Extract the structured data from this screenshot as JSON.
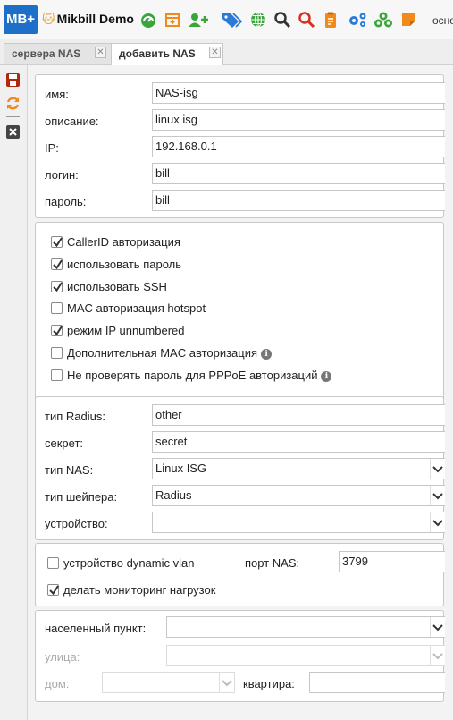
{
  "app": {
    "logo": "MB+",
    "brand": "Mikbill Demo",
    "top_right": "осно"
  },
  "tabs": [
    {
      "label": "сервера NAS"
    },
    {
      "label": "добавить NAS"
    }
  ],
  "toolbar_icons": [
    "dashboard-icon",
    "calendar-icon",
    "add-user-icon",
    "tags-icon",
    "globe-icon",
    "search-icon",
    "search-red-icon",
    "clipboard-icon",
    "gears-icon",
    "network-icon",
    "note-icon"
  ],
  "general": {
    "name_label": "имя:",
    "name_value": "NAS-isg",
    "desc_label": "описание:",
    "desc_value": "linux isg",
    "ip_label": "IP:",
    "ip_value": "192.168.0.1",
    "login_label": "логин:",
    "login_value": "bill",
    "password_label": "пароль:",
    "password_value": "bill"
  },
  "options": [
    {
      "label": "CallerID авторизация",
      "checked": true,
      "info": false
    },
    {
      "label": "использовать пароль",
      "checked": true,
      "info": false
    },
    {
      "label": "использовать SSH",
      "checked": true,
      "info": false
    },
    {
      "label": "MAC авторизация hotspot",
      "checked": false,
      "info": false
    },
    {
      "label": "режим IP unnumbered",
      "checked": true,
      "info": false
    },
    {
      "label": "Дополнительная MAC авторизация",
      "checked": false,
      "info": true
    },
    {
      "label": "Не проверять пароль для PPPoE авторизаций",
      "checked": false,
      "info": true
    }
  ],
  "radius": {
    "type_label": "тип Radius:",
    "type_value": "other",
    "secret_label": "секрет:",
    "secret_value": "secret",
    "nas_type_label": "тип NAS:",
    "nas_type_value": "Linux ISG",
    "shaper_label": "тип шейпера:",
    "shaper_value": "Radius",
    "device_label": "устройство:",
    "device_value": ""
  },
  "vlan": {
    "dynamic_vlan_label": "устройство dynamic vlan",
    "dynamic_vlan_checked": false,
    "nas_port_label": "порт NAS:",
    "nas_port_value": "3799",
    "monitoring_label": "делать мониторинг нагрузок",
    "monitoring_checked": true
  },
  "address": {
    "city_label": "населенный пункт:",
    "city_value": "",
    "street_label": "улица:",
    "street_value": "",
    "house_label": "дом:",
    "house_value": "",
    "apartment_label": "квартира:",
    "apartment_value": ""
  },
  "colors": {
    "logo_bg": "#1e6fc8",
    "accent_green": "#3aa53a",
    "accent_orange": "#f08a1c",
    "accent_blue": "#2a7bd8",
    "accent_red": "#d9301e"
  }
}
